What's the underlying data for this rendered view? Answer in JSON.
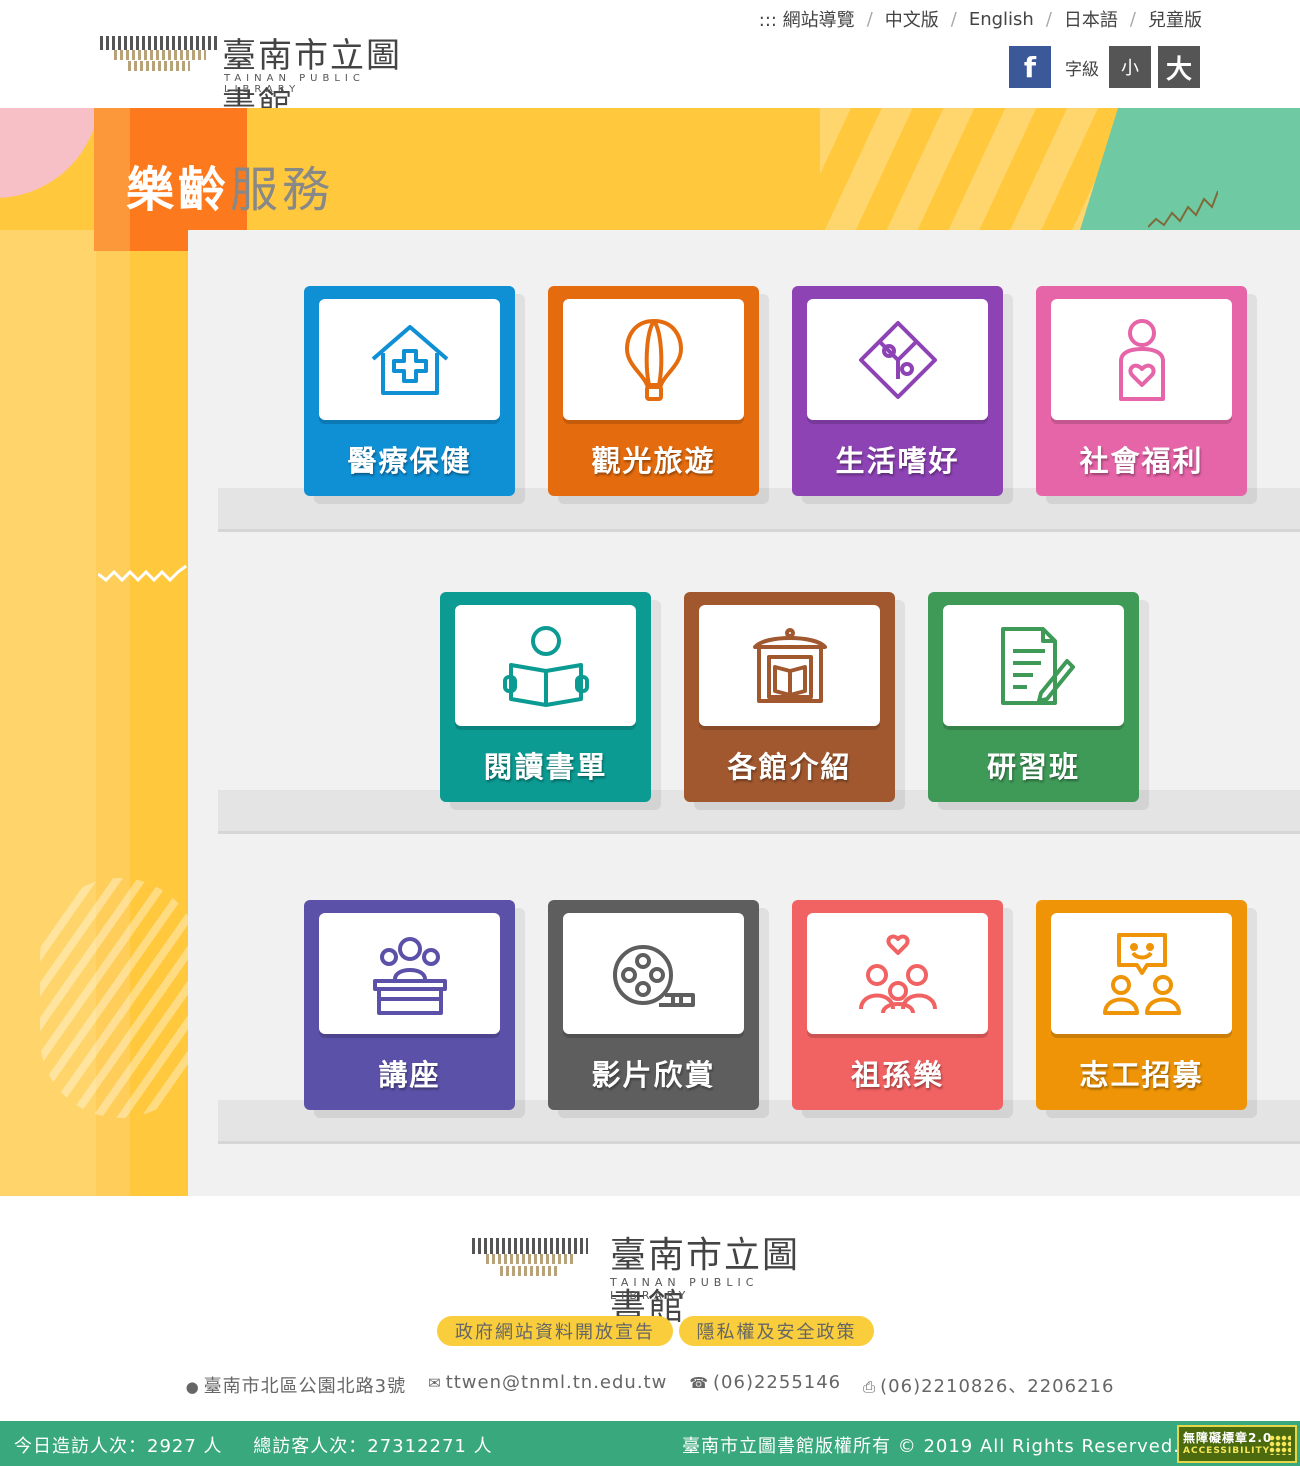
{
  "header": {
    "logo_cn": "臺南市立圖書館",
    "logo_en": "TAINAN PUBLIC LIBRARY",
    "nav": [
      {
        "label": "::: 網站導覽"
      },
      {
        "label": "中文版"
      },
      {
        "label": "English"
      },
      {
        "label": "日本語"
      },
      {
        "label": "兒童版"
      }
    ],
    "facebook_label": "f",
    "font_size_label": "字級",
    "font_small": "小",
    "font_big": "大"
  },
  "hero": {
    "title_bold": "樂齡",
    "title_light": "服務"
  },
  "tiles": [
    {
      "label": "醫療保健",
      "color": "#0f8fd4",
      "icon": "medical-house-icon"
    },
    {
      "label": "觀光旅遊",
      "color": "#e56c0e",
      "icon": "hot-air-balloon-icon"
    },
    {
      "label": "生活嗜好",
      "color": "#8e43b5",
      "icon": "puzzle-icon"
    },
    {
      "label": "社會福利",
      "color": "#e664a8",
      "icon": "person-heart-icon"
    },
    {
      "label": "閱讀書單",
      "color": "#0b9b93",
      "icon": "reader-book-icon"
    },
    {
      "label": "各館介紹",
      "color": "#a1582f",
      "icon": "library-building-icon"
    },
    {
      "label": "研習班",
      "color": "#3f9a58",
      "icon": "document-pen-icon"
    },
    {
      "label": "講座",
      "color": "#5b51a8",
      "icon": "lecture-podium-icon"
    },
    {
      "label": "影片欣賞",
      "color": "#5e5e5e",
      "icon": "film-reel-icon"
    },
    {
      "label": "祖孫樂",
      "color": "#f16262",
      "icon": "family-heart-icon"
    },
    {
      "label": "志工招募",
      "color": "#ee9406",
      "icon": "volunteer-chat-icon"
    }
  ],
  "footer": {
    "logo_cn": "臺南市立圖書館",
    "logo_en": "TAINAN PUBLIC LIBRARY",
    "links": [
      "政府網站資料開放宣告",
      "隱私權及安全政策"
    ],
    "address": "臺南市北區公園北路3號",
    "email": "ttwen@tnml.tn.edu.tw",
    "phone": "(06)2255146",
    "fax": "(06)2210826、2206216",
    "visits_today": "今日造訪人次：2927 人",
    "visits_total": "總訪客人次：27312271 人",
    "copyright": "臺南市立圖書館版權所有 © 2019 All Rights Reserved.",
    "accessibility_badge": "無障礙標章2.0",
    "accessibility_sub": "ACCESSIBILITY"
  }
}
